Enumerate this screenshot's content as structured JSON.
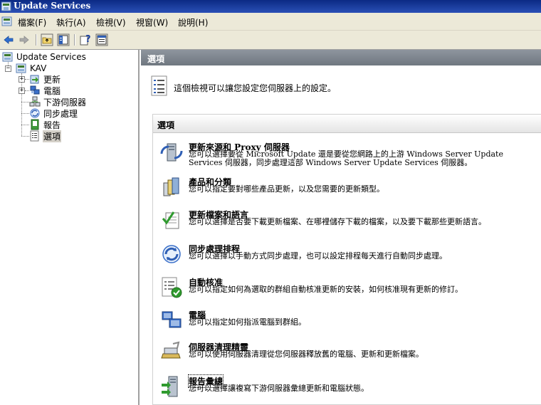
{
  "window": {
    "title": "Update Services"
  },
  "menubar": {
    "items": [
      {
        "label": "檔案(F)"
      },
      {
        "label": "執行(A)"
      },
      {
        "label": "檢視(V)"
      },
      {
        "label": "視窗(W)"
      },
      {
        "label": "說明(H)"
      }
    ]
  },
  "toolbar": {
    "buttons": [
      "back-icon",
      "forward-icon",
      "up-folder-icon",
      "show-hide-tree-icon",
      "help-icon",
      "properties-icon"
    ]
  },
  "tree": {
    "root": "Update Services",
    "server": "KAV",
    "children": [
      {
        "label": "更新"
      },
      {
        "label": "電腦"
      },
      {
        "label": "下游伺服器"
      },
      {
        "label": "同步處理"
      },
      {
        "label": "報告"
      },
      {
        "label": "選項"
      }
    ]
  },
  "main": {
    "header": "選項",
    "description": "這個檢視可以讓您設定您伺服器上的設定。",
    "section_title": "選項",
    "options": [
      {
        "title": "更新來源和 Proxy 伺服器",
        "desc": "您可以選擇要從 Microsoft Update 還是要從您網路上的上游 Windows Server Update Services 伺服器，同步處理這部 Windows Server Update Services 伺服器。"
      },
      {
        "title": "產品和分類",
        "desc": "您可以指定要對哪些產品更新，以及您需要的更新類型。"
      },
      {
        "title": "更新檔案和語言",
        "desc": "您可以選擇是否要下載更新檔案、在哪裡儲存下載的檔案，以及要下載那些更新語言。"
      },
      {
        "title": "同步處理排程",
        "desc": "您可以選擇以手動方式同步處理，也可以設定排程每天進行自動同步處理。"
      },
      {
        "title": "自動核准",
        "desc": "您可以指定如何為選取的群組自動核准更新的安裝，如何核准現有更新的修訂。"
      },
      {
        "title": "電腦",
        "desc": "您可以指定如何指派電腦到群組。"
      },
      {
        "title": "伺服器清理精靈",
        "desc": "您可以使用伺服器清理從您伺服器釋放舊的電腦、更新和更新檔案。"
      },
      {
        "title": "報告彙總",
        "desc": "您可以選擇讓複寫下游伺服器彙總更新和電腦狀態。"
      }
    ]
  }
}
